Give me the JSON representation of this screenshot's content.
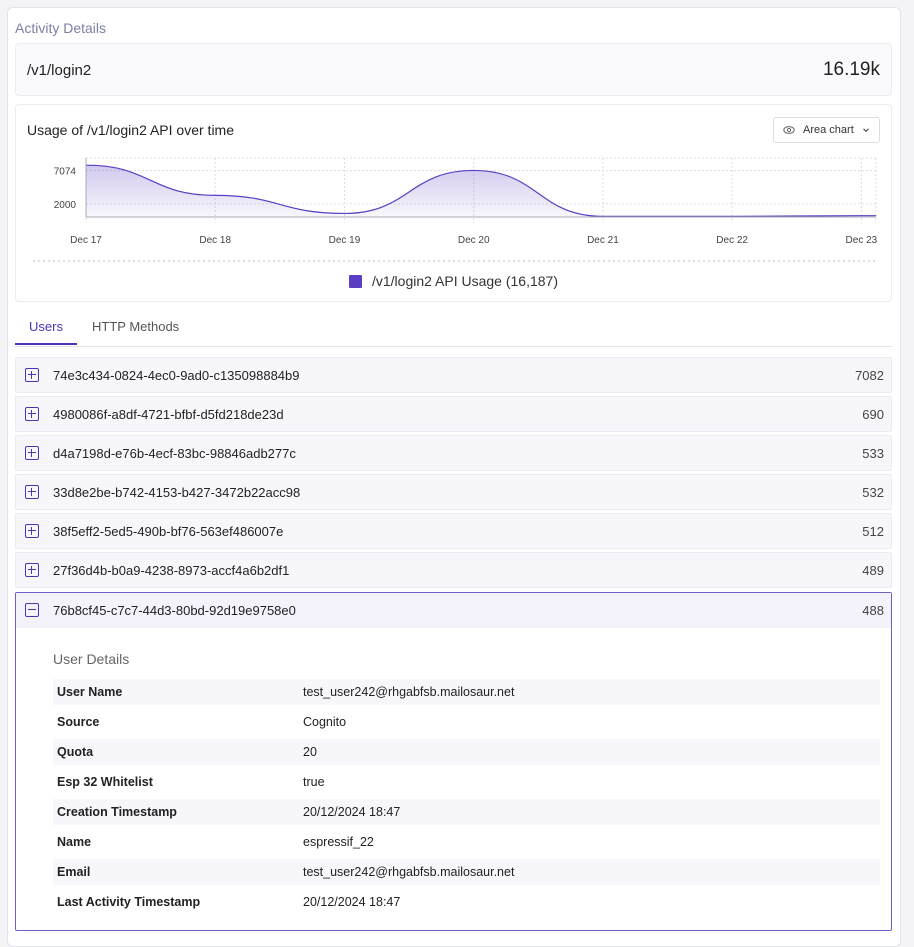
{
  "section_title": "Activity Details",
  "summary": {
    "endpoint": "/v1/login2",
    "total": "16.19k"
  },
  "chart": {
    "title": "Usage of /v1/login2 API over time",
    "type_selector": "Area chart",
    "legend": "/v1/login2 API Usage (16,187)",
    "accent_color": "#5b3ec3"
  },
  "chart_data": {
    "type": "area",
    "title": "Usage of /v1/login2 API over time",
    "x": [
      "Dec 17",
      "Dec 18",
      "Dec 19",
      "Dec 20",
      "Dec 21",
      "Dec 22",
      "Dec 23"
    ],
    "y_ticks": [
      2000,
      7074
    ],
    "ylim": [
      0,
      9000
    ],
    "grid": true,
    "legend_position": "bottom",
    "series": [
      {
        "name": "/v1/login2 API Usage (16,187)",
        "values": [
          7900,
          3300,
          540,
          7100,
          100,
          100,
          200
        ]
      }
    ]
  },
  "tabs": [
    {
      "label": "Users",
      "active": true
    },
    {
      "label": "HTTP Methods",
      "active": false
    }
  ],
  "users": [
    {
      "id": "74e3c434-0824-4ec0-9ad0-c135098884b9",
      "count": "7082"
    },
    {
      "id": "4980086f-a8df-4721-bfbf-d5fd218de23d",
      "count": "690"
    },
    {
      "id": "d4a7198d-e76b-4ecf-83bc-98846adb277c",
      "count": "533"
    },
    {
      "id": "33d8e2be-b742-4153-b427-3472b22acc98",
      "count": "532"
    },
    {
      "id": "38f5eff2-5ed5-490b-bf76-563ef486007e",
      "count": "512"
    },
    {
      "id": "27f36d4b-b0a9-4238-8973-accf4a6b2df1",
      "count": "489"
    }
  ],
  "expanded_user": {
    "id": "76b8cf45-c7c7-44d3-80bd-92d19e9758e0",
    "count": "488",
    "details_title": "User Details",
    "details": [
      {
        "key": "User Name",
        "value": "test_user242@rhgabfsb.mailosaur.net"
      },
      {
        "key": "Source",
        "value": "Cognito"
      },
      {
        "key": "Quota",
        "value": "20"
      },
      {
        "key": "Esp 32 Whitelist",
        "value": "true"
      },
      {
        "key": "Creation Timestamp",
        "value": "20/12/2024 18:47"
      },
      {
        "key": "Name",
        "value": "espressif_22"
      },
      {
        "key": "Email",
        "value": "test_user242@rhgabfsb.mailosaur.net"
      },
      {
        "key": "Last Activity Timestamp",
        "value": "20/12/2024 18:47"
      }
    ]
  }
}
